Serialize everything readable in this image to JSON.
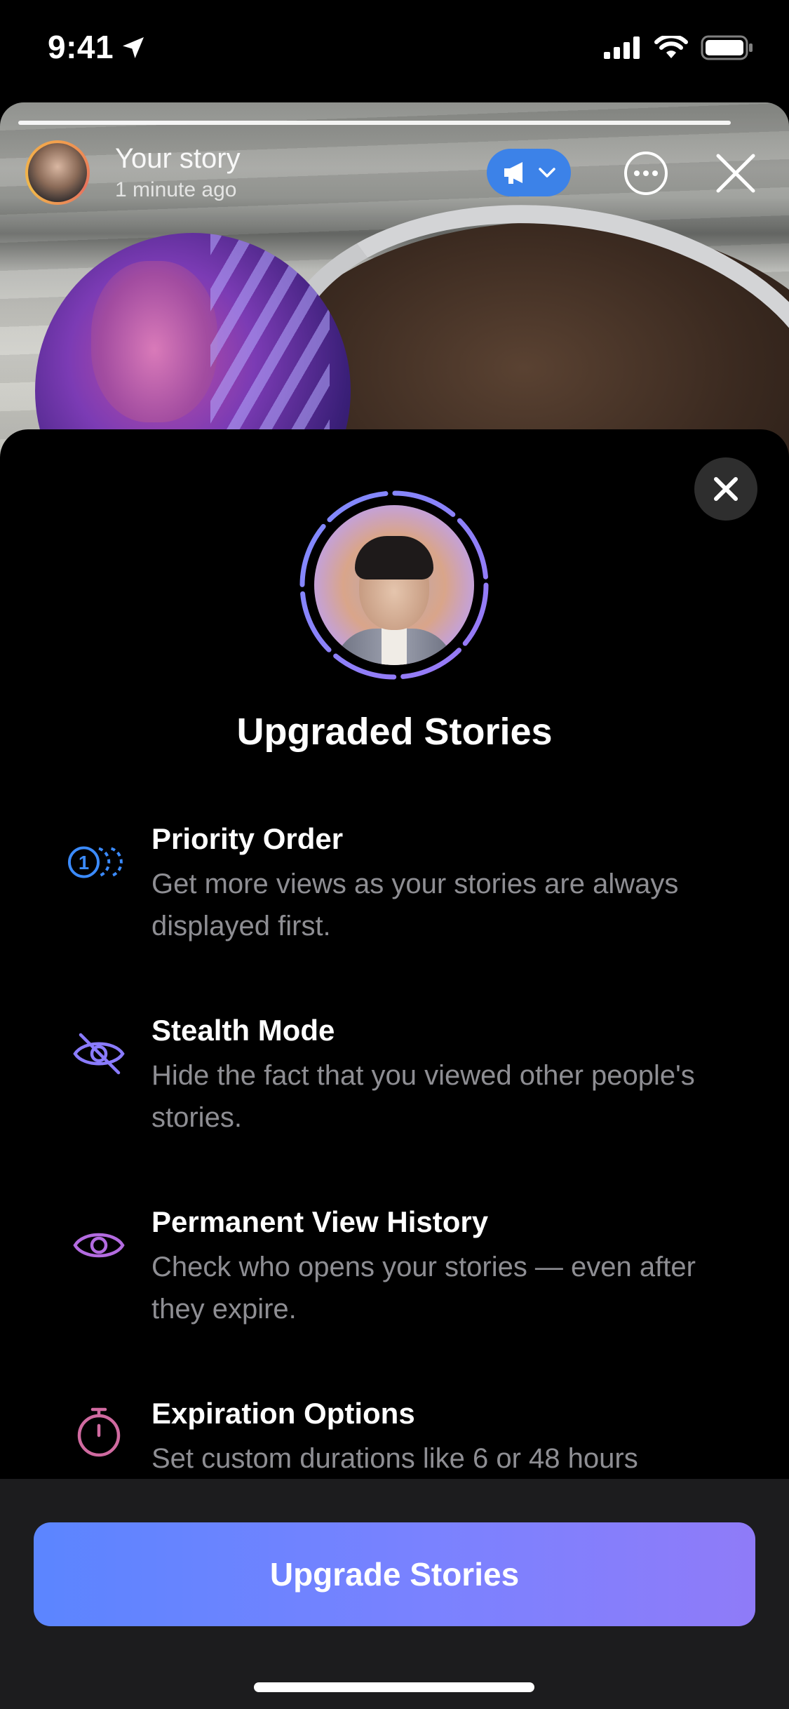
{
  "status_bar": {
    "time": "9:41"
  },
  "story_header": {
    "title": "Your story",
    "subtitle": "1 minute ago"
  },
  "sheet": {
    "title": "Upgraded Stories",
    "features": [
      {
        "icon": "priority-order-icon",
        "title": "Priority Order",
        "description": "Get more views as your stories are always displayed first.",
        "color": "#3b8bff"
      },
      {
        "icon": "eye-slash-icon",
        "title": "Stealth Mode",
        "description": "Hide the fact that you viewed other people's stories.",
        "color": "#8a7bff"
      },
      {
        "icon": "eye-icon",
        "title": "Permanent View History",
        "description": "Check who opens your stories — even after they expire.",
        "color": "#b36be0"
      },
      {
        "icon": "stopwatch-icon",
        "title": "Expiration Options",
        "description": "Set custom durations like 6 or 48 hours",
        "color": "#d06aa0"
      }
    ]
  },
  "cta": {
    "label": "Upgrade Stories"
  },
  "colors": {
    "cta_gradient_start": "#5b85ff",
    "cta_gradient_end": "#8f7bf8",
    "promo_pill": "#3c82e8",
    "sheet_background": "#000000",
    "footer_background": "#1c1c1e"
  }
}
